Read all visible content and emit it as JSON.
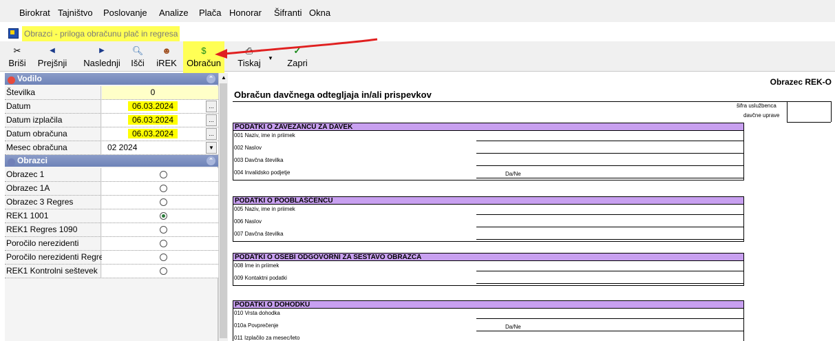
{
  "menu": [
    {
      "label": "Birokrat",
      "name": "menu-birokrat"
    },
    {
      "label": "Tajništvo",
      "name": "menu-tajnistvo"
    },
    {
      "label": "Poslovanje",
      "name": "menu-poslovanje"
    },
    {
      "label": "Analize",
      "name": "menu-analize"
    },
    {
      "label": "Plača",
      "name": "menu-placa"
    },
    {
      "label": "Honorar",
      "name": "menu-honorar"
    },
    {
      "label": "Šifranti",
      "name": "menu-sifranti"
    },
    {
      "label": "Okna",
      "name": "menu-okna"
    }
  ],
  "form_title": "Obrazci - priloga obračunu plač in regresa",
  "toolbar": {
    "brisi": "Briši",
    "prejsnji": "Prejšnji",
    "naslednji": "Naslednji",
    "isci": "Išči",
    "irek": "iREK",
    "obracun": "Obračun",
    "tiskaj": "Tiskaj",
    "zapri": "Zapri"
  },
  "left": {
    "vodilo_header": "Vodilo",
    "fields": {
      "stevilka_label": "Številka",
      "stevilka_value": "0",
      "datum_label": "Datum",
      "datum_value": "06.03.2024",
      "datum_izplacila_label": "Datum izplačila",
      "datum_izplacila_value": "06.03.2024",
      "datum_obracuna_label": "Datum obračuna",
      "datum_obracuna_value": "06.03.2024",
      "mesec_label": "Mesec obračuna",
      "mesec_value": "02  2024",
      "dots": "..."
    },
    "obrazci_header": "Obrazci",
    "obrazci": [
      {
        "label": "Obrazec 1",
        "selected": false
      },
      {
        "label": "Obrazec 1A",
        "selected": false
      },
      {
        "label": "Obrazec 3 Regres",
        "selected": false
      },
      {
        "label": "REK1 1001",
        "selected": true
      },
      {
        "label": "REK1 Regres 1090",
        "selected": false
      },
      {
        "label": "Poročilo nerezidenti",
        "selected": false
      },
      {
        "label": "Poročilo nerezidenti Regres",
        "selected": false
      },
      {
        "label": "REK1 Kontrolni seštevek",
        "selected": false
      }
    ]
  },
  "report": {
    "title": "Obrazec REK-O",
    "heading": "Obračun davčnega odtegljaja in/ali prispevkov",
    "sifra_line1": "šifra uslužbenca",
    "sifra_line2": "davčne uprave",
    "sections": [
      {
        "title": "PODATKI O ZAVEZANCU ZA DAVEK",
        "fields": [
          {
            "label": "001  Naziv, ime in priimek"
          },
          {
            "label": "002  Naslov"
          },
          {
            "label": "003  Davčna številka"
          },
          {
            "label": "004  Invalidsko podjetje",
            "extra": "Da/Ne"
          }
        ]
      },
      {
        "title": "PODATKI O POOBLAŠČENCU",
        "fields": [
          {
            "label": "005  Naziv, ime in priimek"
          },
          {
            "label": "006  Naslov"
          },
          {
            "label": "007  Davčna številka"
          }
        ]
      },
      {
        "title": "PODATKI O OSEBI ODGOVORNI ZA SESTAVO OBRAZCA",
        "fields": [
          {
            "label": "008  Ime in priimek"
          },
          {
            "label": "009  Kontaktni podatki"
          }
        ]
      },
      {
        "title": "PODATKI O DOHODKU",
        "fields": [
          {
            "label": "010  Vrsta dohodka"
          },
          {
            "label": "010a Povprečenje",
            "extra": "Da/Ne"
          },
          {
            "label": "011  Izplačilo za mesec/leto"
          }
        ]
      }
    ]
  },
  "colors": {
    "highlight": "#ffff55",
    "section_bar": "#c8a0f0",
    "panel_header": "#7a8dc0",
    "arrow": "#e02020"
  }
}
